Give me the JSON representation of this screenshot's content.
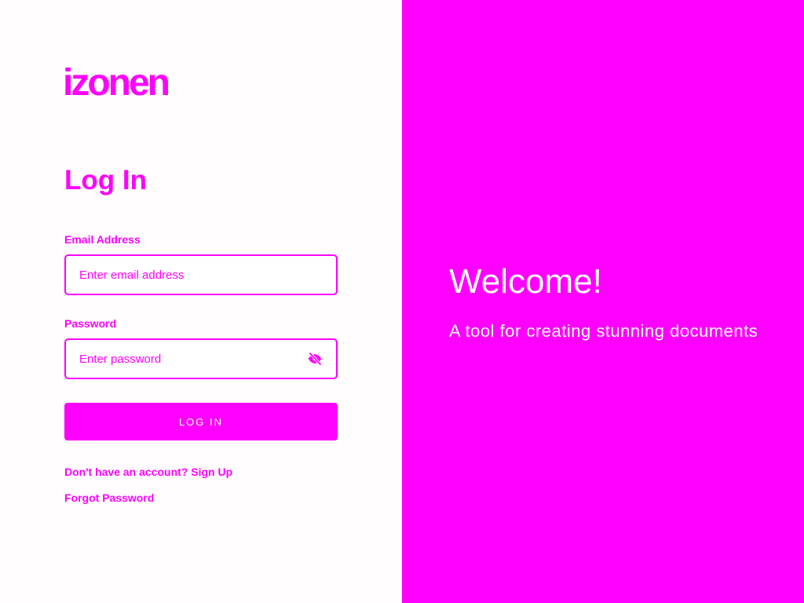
{
  "brand": {
    "logo": "izonen",
    "accent": "#ff00ff"
  },
  "form": {
    "title": "Log In",
    "email_label": "Email Address",
    "email_placeholder": "Enter email address",
    "password_label": "Password",
    "password_placeholder": "Enter password",
    "toggle_icon": "eye-off-icon",
    "submit_label": "LOG IN",
    "signup_prompt": "Don't have an account?",
    "signup_link": "Sign Up",
    "forgot_link": "Forgot Password"
  },
  "hero": {
    "heading": "Welcome!",
    "subheading": "A tool for creating stunning documents"
  }
}
